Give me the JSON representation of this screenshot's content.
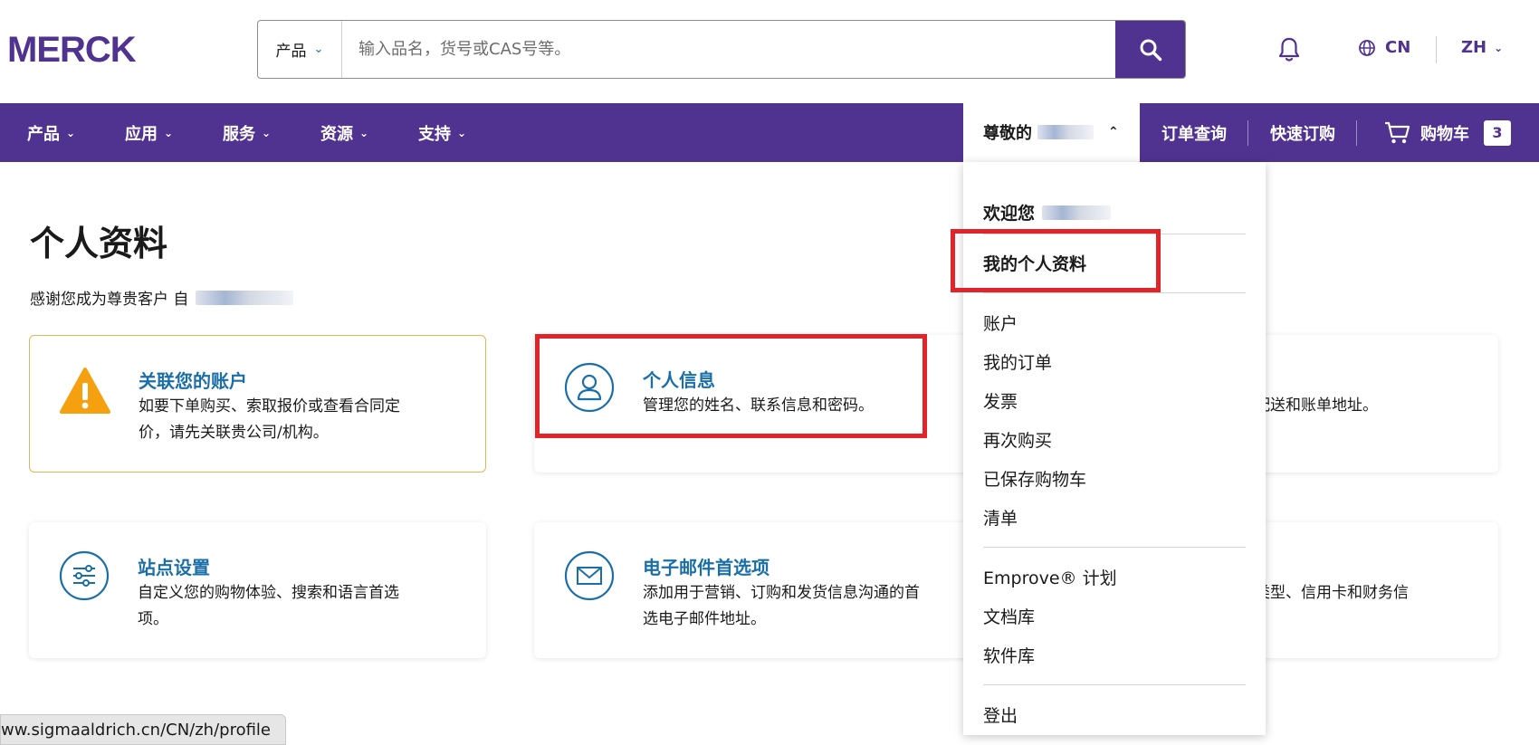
{
  "brand": {
    "logo_text": "MERCK",
    "accent": "#503291",
    "link": "#1b6fa8"
  },
  "search": {
    "category": "产品",
    "placeholder": "输入品名，货号或CAS号等。"
  },
  "header": {
    "region": "CN",
    "language": "ZH"
  },
  "nav": {
    "items": [
      "产品",
      "应用",
      "服务",
      "资源",
      "支持"
    ],
    "greeting": "尊敬的",
    "order_lookup": "订单查询",
    "quick_order": "快速订购",
    "cart_label": "购物车",
    "cart_count": "3"
  },
  "main": {
    "title": "个人资料",
    "since_text": "感谢您成为尊贵客户 自",
    "cards": [
      {
        "title": "关联您的账户",
        "desc1": "如要下单购买、索取报价或查看合同定",
        "desc2": "价，请先关联贵公司/机构。"
      },
      {
        "title": "个人信息",
        "desc1": "管理您的姓名、联系信息和密码。",
        "desc2": ""
      },
      {
        "title": "",
        "desc1": "配送和账单地址。",
        "desc2": ""
      },
      {
        "title": "站点设置",
        "desc1": "自定义您的购物体验、搜索和语言首选",
        "desc2": "项。"
      },
      {
        "title": "电子邮件首选项",
        "desc1": "添加用于营销、订购和发货信息沟通的首",
        "desc2": "选电子邮件地址。"
      },
      {
        "title": "",
        "desc1": "类型、信用卡和财务信",
        "desc2": ""
      }
    ]
  },
  "dropdown": {
    "welcome": "欢迎您",
    "my_profile": "我的个人资料",
    "group1": [
      "账户",
      "我的订单",
      "发票",
      "再次购买",
      "已保存购物车",
      "清单"
    ],
    "group2": [
      "Emprove® 计划",
      "文档库",
      "软件库"
    ],
    "logout": "登出"
  },
  "status_bar": {
    "url": "ww.sigmaaldrich.cn/CN/zh/profile"
  }
}
